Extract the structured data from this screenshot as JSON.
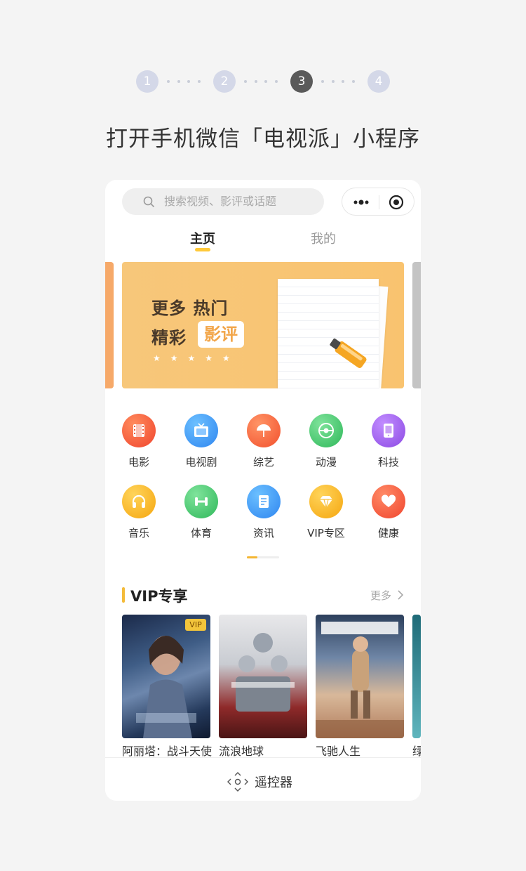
{
  "steps": [
    "1",
    "2",
    "3",
    "4"
  ],
  "active_step": "3",
  "instruction": "打开手机微信「电视派」小程序",
  "search": {
    "placeholder": "搜索视频、影评或话题"
  },
  "tabs": [
    {
      "label": "主页",
      "active": true
    },
    {
      "label": "我的",
      "active": false
    }
  ],
  "banner": {
    "line1": "更多  热门",
    "line2": "精彩",
    "tag": "影评",
    "stars": "★★★★★"
  },
  "categories": [
    {
      "label": "电影",
      "icon": "film-icon",
      "color": "#f25a3a"
    },
    {
      "label": "电视剧",
      "icon": "tv-icon",
      "color": "#3d9bf5"
    },
    {
      "label": "综艺",
      "icon": "umbrella-icon",
      "color": "#f7663a"
    },
    {
      "label": "动漫",
      "icon": "anime-ball-icon",
      "color": "#3ec46a"
    },
    {
      "label": "科技",
      "icon": "tablet-icon",
      "color": "#a25ae8"
    },
    {
      "label": "音乐",
      "icon": "headphones-icon",
      "color": "#f9b51e"
    },
    {
      "label": "体育",
      "icon": "dumbbell-icon",
      "color": "#3ec46a"
    },
    {
      "label": "资讯",
      "icon": "news-icon",
      "color": "#3d9bf5"
    },
    {
      "label": "VIP专区",
      "icon": "diamond-icon",
      "color": "#f9b51e"
    },
    {
      "label": "健康",
      "icon": "heart-icon",
      "color": "#f5583a"
    }
  ],
  "vip": {
    "title": "VIP专享",
    "more": "更多",
    "badge": "VIP",
    "items": [
      {
        "title": "阿丽塔：战斗天使"
      },
      {
        "title": "流浪地球"
      },
      {
        "title": "飞驰人生"
      },
      {
        "title": "绿"
      }
    ]
  },
  "bottom": {
    "label": "遥控器"
  }
}
